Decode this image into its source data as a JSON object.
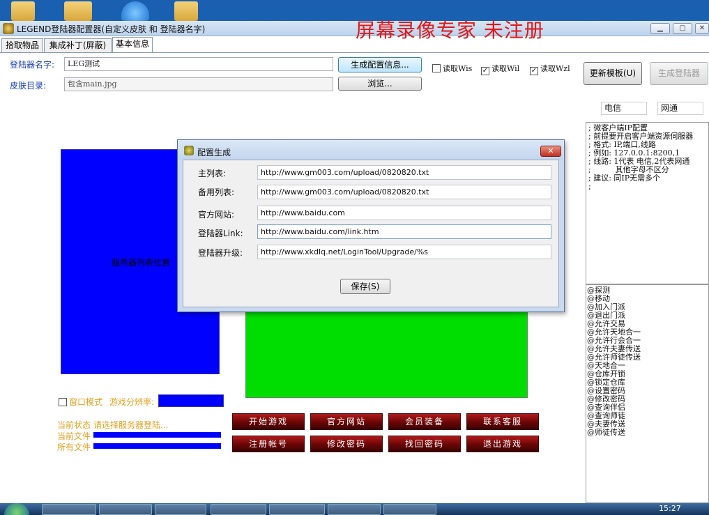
{
  "window": {
    "title": "LEGEND登陆器配置器(自定义皮肤 和 登陆器名字)",
    "watermark": "屏幕录像专家  未注册",
    "minimize_icon": "minimize-icon",
    "maximize_icon": "maximize-icon",
    "close_icon": "close-icon"
  },
  "tabs": [
    {
      "label": "拾取物品"
    },
    {
      "label": "集成补丁(屏蔽)"
    },
    {
      "label": "基本信息",
      "active": true
    }
  ],
  "form": {
    "launcher_name_label": "登陆器名字:",
    "launcher_name_value": "LEG测试",
    "skin_dir_label": "皮肤目录:",
    "skin_dir_value": "包含main.jpg",
    "generate_config_button": "生成配置信息...",
    "browse_button": "浏览...",
    "read_wis_label": "读取Wis",
    "read_wis_checked": false,
    "read_wil_label": "读取Wil",
    "read_wil_checked": true,
    "read_wzl_label": "读取Wzl",
    "read_wzl_checked": true,
    "update_template_button": "更新模板(U)",
    "generate_launcher_button": "生成登陆器"
  },
  "network": {
    "telecom_label": "电信",
    "netcom_label": "网通"
  },
  "ip_config_panel": {
    "lines": [
      "; 微客户端IP配置",
      "",
      "; 前提要开启客户端资源伺服器",
      "; 格式: IP,端口,线路",
      "; 例如: 127.0.0.1:8200,1",
      "; 线路: 1代表 电信,2代表网通",
      ";          其他字母不区分",
      "; 建议: 同IP无需多个",
      ";"
    ]
  },
  "commands_panel": {
    "lines": [
      "@探测",
      "@移动",
      "@加入门派",
      "@退出门派",
      "@允许交易",
      "@允许天地合一",
      "@允许行会合一",
      "@允许夫妻传送",
      "@允许师徒传送",
      "@天地合一",
      "@仓库开锁",
      "@锁定仓库",
      "@设置密码",
      "@修改密码",
      "@查询伴侣",
      "@查询师徒",
      "@夫妻传送",
      "@师徒传送"
    ]
  },
  "preview": {
    "server_list_label": "服务器列表位置",
    "window_mode_label": "窗口模式",
    "resolution_label": "游戏分辨率:",
    "window_mode_checked": false,
    "status_label": "当前状态",
    "status_text": "请选择服务器登陆...",
    "current_file_label": "当前文件",
    "all_files_label": "所有文件",
    "buttons_row1": [
      "开始游戏",
      "官方网站",
      "会员装备",
      "联系客服"
    ],
    "buttons_row2": [
      "注册帐号",
      "修改密码",
      "找回密码",
      "退出游戏"
    ]
  },
  "dialog": {
    "title": "配置生成",
    "close_icon": "close-icon",
    "fields": [
      {
        "label": "主列表:",
        "value": "http://www.gm003.com/upload/0820820.txt"
      },
      {
        "label": "备用列表:",
        "value": "http://www.gm003.com/upload/0820820.txt"
      },
      {
        "label": "官方网站:",
        "value": "http://www.baidu.com"
      },
      {
        "label": "登陆器Link:",
        "value": "http://www.baidu.com/link.htm"
      },
      {
        "label": "登陆器升级:",
        "value": "http://www.xkdlq.net/LoginTool/Upgrade/%s"
      }
    ],
    "save_button": "保存(S)"
  },
  "taskbar": {
    "clock": "15:27",
    "start_icon": "windows-start-icon"
  },
  "colors": {
    "accent_blue": "#0000ff",
    "preview_green": "#00dd00",
    "game_button_red": "#8a0a0a",
    "label_blue": "#1a3fb0",
    "status_orange": "#e0a020",
    "watermark_red": "#e01818"
  }
}
